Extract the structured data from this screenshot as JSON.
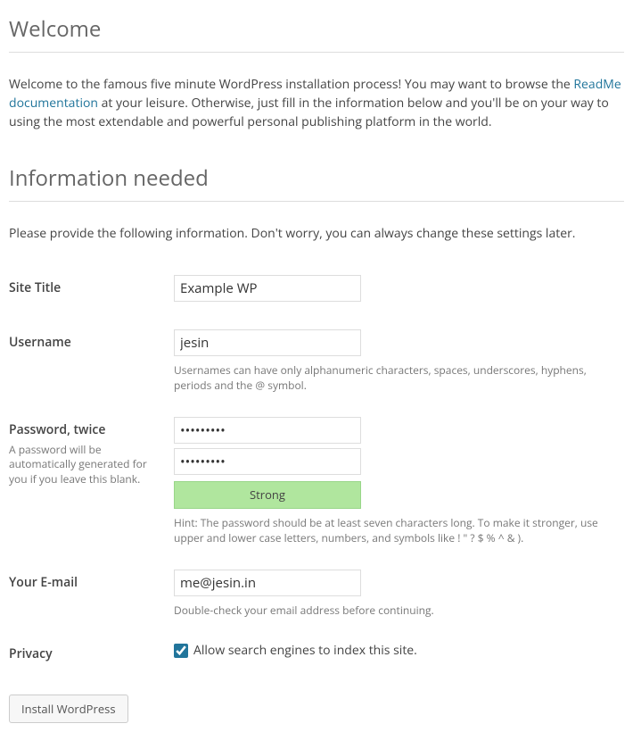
{
  "headings": {
    "welcome": "Welcome",
    "info_needed": "Information needed"
  },
  "intro": {
    "pre_link": "Welcome to the famous five minute WordPress installation process! You may want to browse the ",
    "link_text": "ReadMe documentation",
    "post_link": " at your leisure. Otherwise, just fill in the information below and you'll be on your way to using the most extendable and powerful personal publishing platform in the world."
  },
  "subtext": "Please provide the following information. Don't worry, you can always change these settings later.",
  "fields": {
    "site_title": {
      "label": "Site Title",
      "value": "Example WP"
    },
    "username": {
      "label": "Username",
      "value": "jesin",
      "desc": "Usernames can have only alphanumeric characters, spaces, underscores, hyphens, periods and the @ symbol."
    },
    "password": {
      "label": "Password, twice",
      "label_desc": "A password will be automatically generated for you if you leave this blank.",
      "value1": "•••••••••",
      "value2": "•••••••••",
      "strength": "Strong",
      "hint": "Hint: The password should be at least seven characters long. To make it stronger, use upper and lower case letters, numbers, and symbols like ! \" ? $ % ^ & )."
    },
    "email": {
      "label": "Your E-mail",
      "value": "me@jesin.in",
      "desc": "Double-check your email address before continuing."
    },
    "privacy": {
      "label": "Privacy",
      "checkbox_label": "Allow search engines to index this site.",
      "checked": true
    }
  },
  "submit": {
    "label": "Install WordPress"
  }
}
